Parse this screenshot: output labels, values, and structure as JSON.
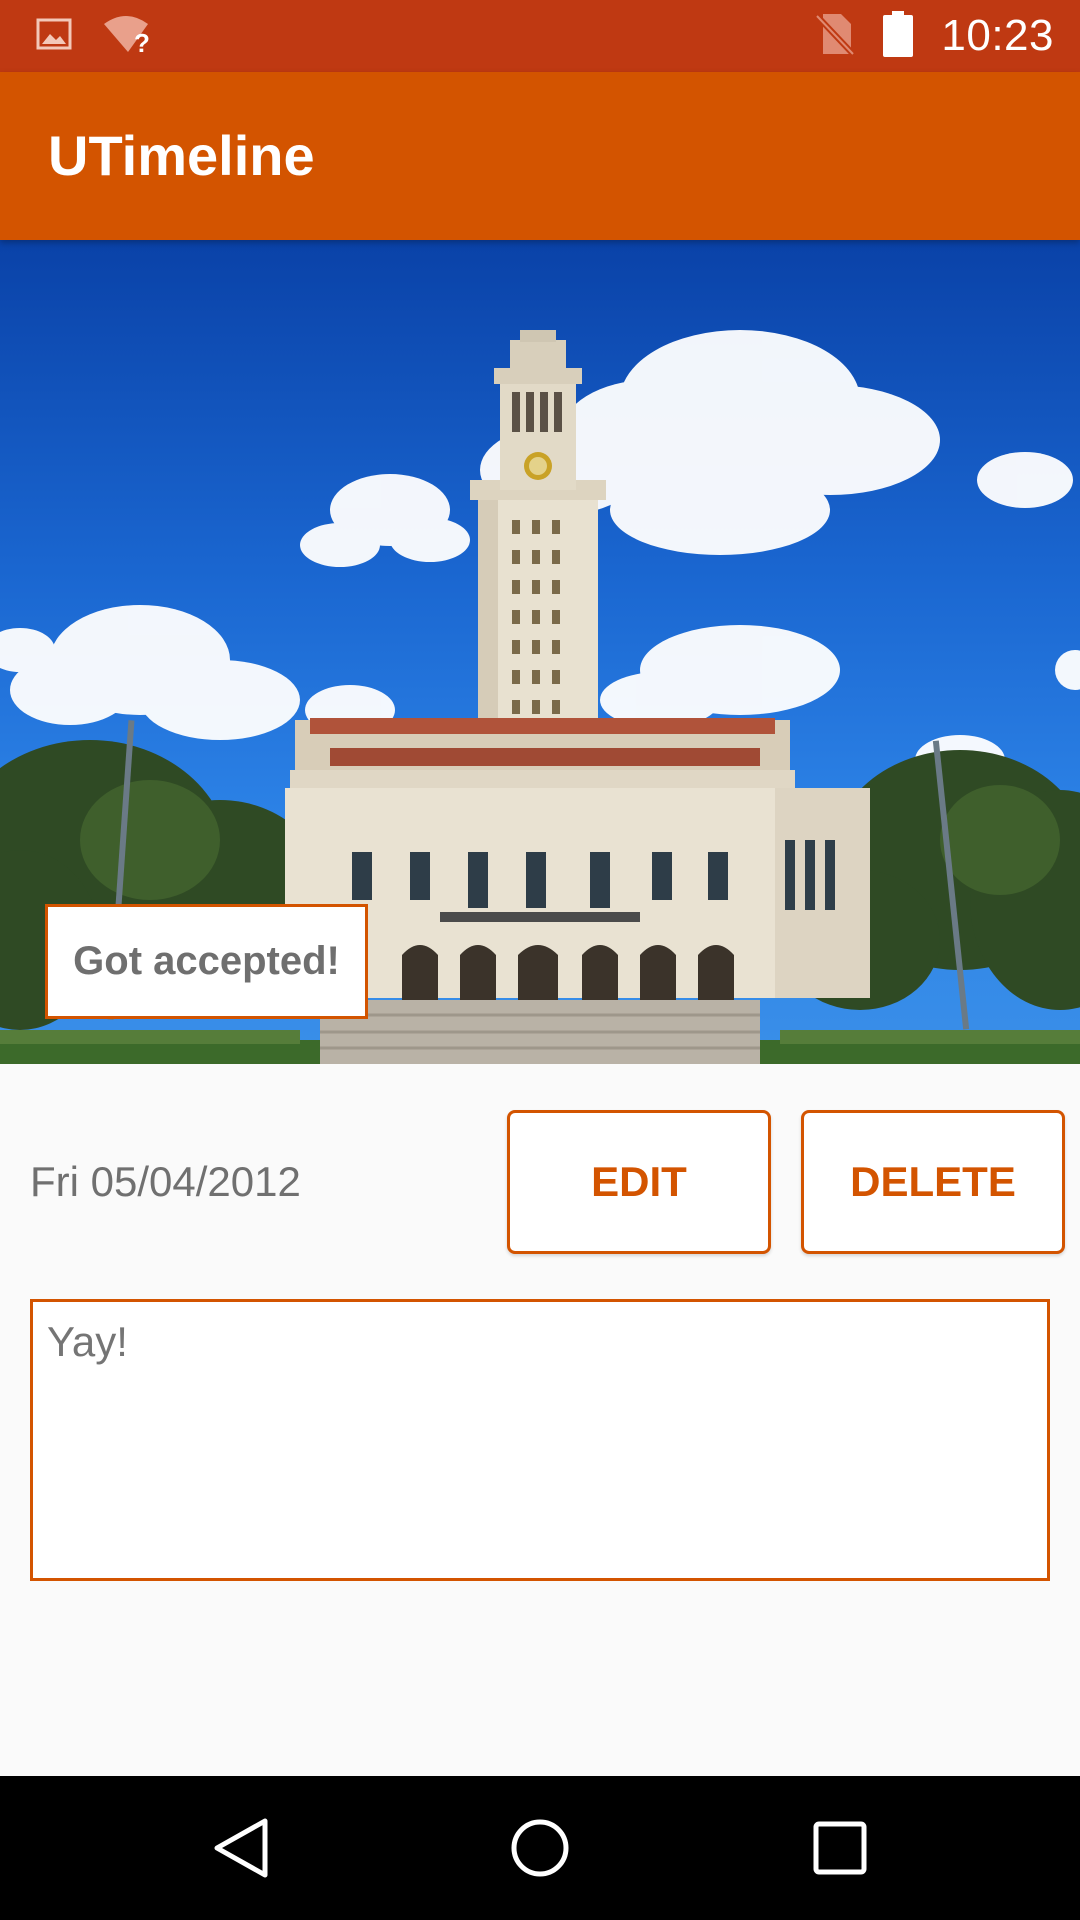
{
  "status_bar": {
    "time": "10:23",
    "icons": [
      "image-icon",
      "wifi-unknown-icon",
      "no-sim-icon",
      "battery-icon"
    ],
    "background": "#bf3912"
  },
  "app_bar": {
    "title": "UTimeline",
    "background": "#d35400"
  },
  "entry": {
    "caption": "Got accepted!",
    "date": "Fri 05/04/2012",
    "edit_label": "EDIT",
    "delete_label": "DELETE",
    "note": "Yay!"
  },
  "nav_bar": {
    "icons": [
      "back-icon",
      "home-icon",
      "recents-icon"
    ]
  },
  "colors": {
    "accent": "#d35400",
    "status": "#bf3912",
    "text_muted": "#707070"
  }
}
